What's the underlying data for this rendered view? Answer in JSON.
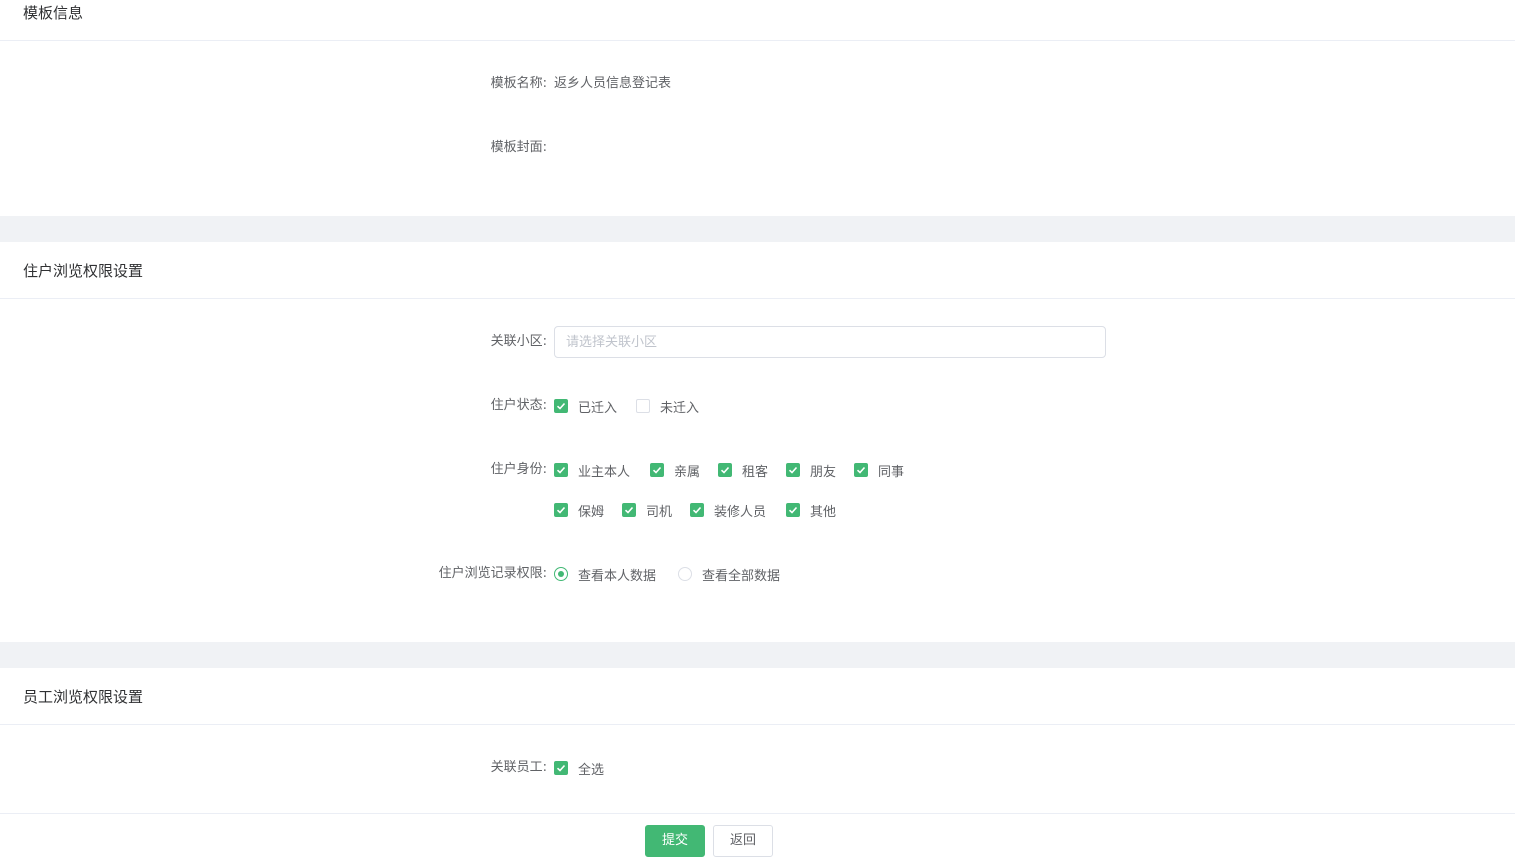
{
  "template_section": {
    "title": "模板信息",
    "name_label": "模板名称:",
    "name_value": "返乡人员信息登记表",
    "cover_label": "模板封面:"
  },
  "resident_section": {
    "title": "住户浏览权限设置",
    "community_label": "关联小区:",
    "community_placeholder": "请选择关联小区",
    "status_label": "住户状态:",
    "status_options": [
      {
        "label": "已迁入",
        "checked": true
      },
      {
        "label": "未迁入",
        "checked": false
      }
    ],
    "identity_label": "住户身份:",
    "identity_options": [
      {
        "label": "业主本人",
        "checked": true
      },
      {
        "label": "亲属",
        "checked": true
      },
      {
        "label": "租客",
        "checked": true
      },
      {
        "label": "朋友",
        "checked": true
      },
      {
        "label": "同事",
        "checked": true
      },
      {
        "label": "保姆",
        "checked": true
      },
      {
        "label": "司机",
        "checked": true
      },
      {
        "label": "装修人员",
        "checked": true
      },
      {
        "label": "其他",
        "checked": true
      }
    ],
    "record_label": "住户浏览记录权限:",
    "record_options": [
      {
        "label": "查看本人数据",
        "checked": true
      },
      {
        "label": "查看全部数据",
        "checked": false
      }
    ]
  },
  "staff_section": {
    "title": "员工浏览权限设置",
    "staff_label": "关联员工:",
    "select_all_label": "全选",
    "select_all_checked": true
  },
  "footer": {
    "submit_label": "提交",
    "back_label": "返回"
  },
  "colors": {
    "accent": "#42b874",
    "gap": "#f0f2f5"
  }
}
